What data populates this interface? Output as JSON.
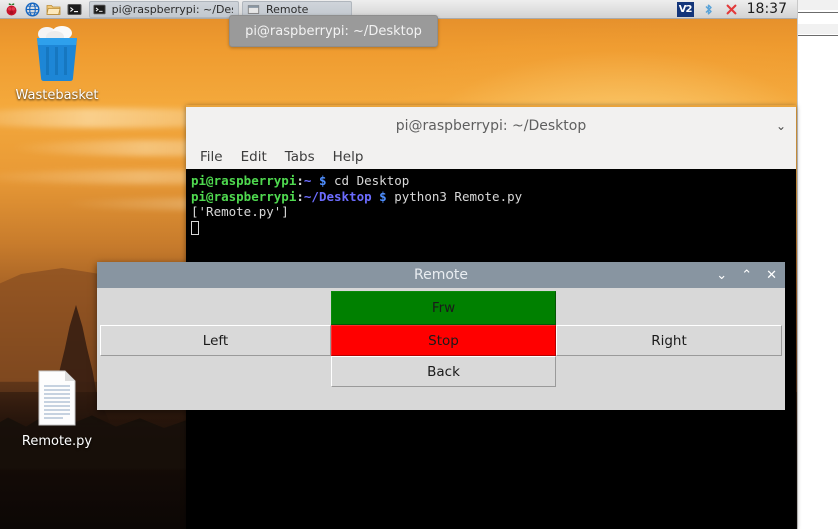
{
  "taskbar": {
    "launchers": [
      {
        "name": "raspberry-menu-icon",
        "label": "Raspberry Pi Menu"
      },
      {
        "name": "browser-icon",
        "label": "Web Browser"
      },
      {
        "name": "file-manager-icon",
        "label": "File Manager"
      },
      {
        "name": "terminal-icon",
        "label": "Terminal"
      }
    ],
    "windows": [
      {
        "name": "taskbar-window-terminal",
        "label": "pi@raspberrypi: ~/Desk"
      },
      {
        "name": "taskbar-window-remote",
        "label": "Remote"
      }
    ],
    "tray": {
      "vnc_label": "V2",
      "bluetooth_label": "Bluetooth",
      "network_label": "Network"
    },
    "clock": "18:37"
  },
  "tooltip": {
    "text": "pi@raspberrypi: ~/Desktop"
  },
  "desktop": {
    "icons": [
      {
        "name": "desktop-icon-wastebasket",
        "label": "Wastebasket",
        "icon": "trash-icon"
      },
      {
        "name": "desktop-icon-remotepy",
        "label": "Remote.py",
        "icon": "document-icon"
      }
    ]
  },
  "terminal": {
    "title": "pi@raspberrypi: ~/Desktop",
    "chevron": "⌄",
    "menu": [
      "File",
      "Edit",
      "Tabs",
      "Help"
    ],
    "lines": [
      {
        "user": "pi@raspberrypi",
        "colon": ":",
        "path": "~",
        "dollar": "$",
        "command": " cd Desktop"
      },
      {
        "user": "pi@raspberrypi",
        "colon": ":",
        "path": "~/Desktop",
        "dollar": "$",
        "command": " python3 Remote.py"
      }
    ],
    "output": "['Remote.py']",
    "colors": {
      "background": "#000000",
      "user": "#4fd94f",
      "path": "#6c6cff",
      "prompt": "#4f8fff",
      "text": "#d8d8d8"
    }
  },
  "remote_window": {
    "title": "Remote",
    "window_buttons": {
      "minimize": "⌄",
      "maximize": "⌃",
      "close": "✕"
    },
    "buttons": [
      {
        "name": "remote-button-frw",
        "label": "Frw",
        "color": "#008000",
        "text_color": "#000000"
      },
      {
        "name": "remote-button-left",
        "label": "Left",
        "color": "#d9d9d9",
        "text_color": "#1a1a1a"
      },
      {
        "name": "remote-button-stop",
        "label": "Stop",
        "color": "#ff0000",
        "text_color": "#000000"
      },
      {
        "name": "remote-button-right",
        "label": "Right",
        "color": "#d9d9d9",
        "text_color": "#1a1a1a"
      },
      {
        "name": "remote-button-back",
        "label": "Back",
        "color": "#d9d9d9",
        "text_color": "#1a1a1a"
      }
    ]
  }
}
